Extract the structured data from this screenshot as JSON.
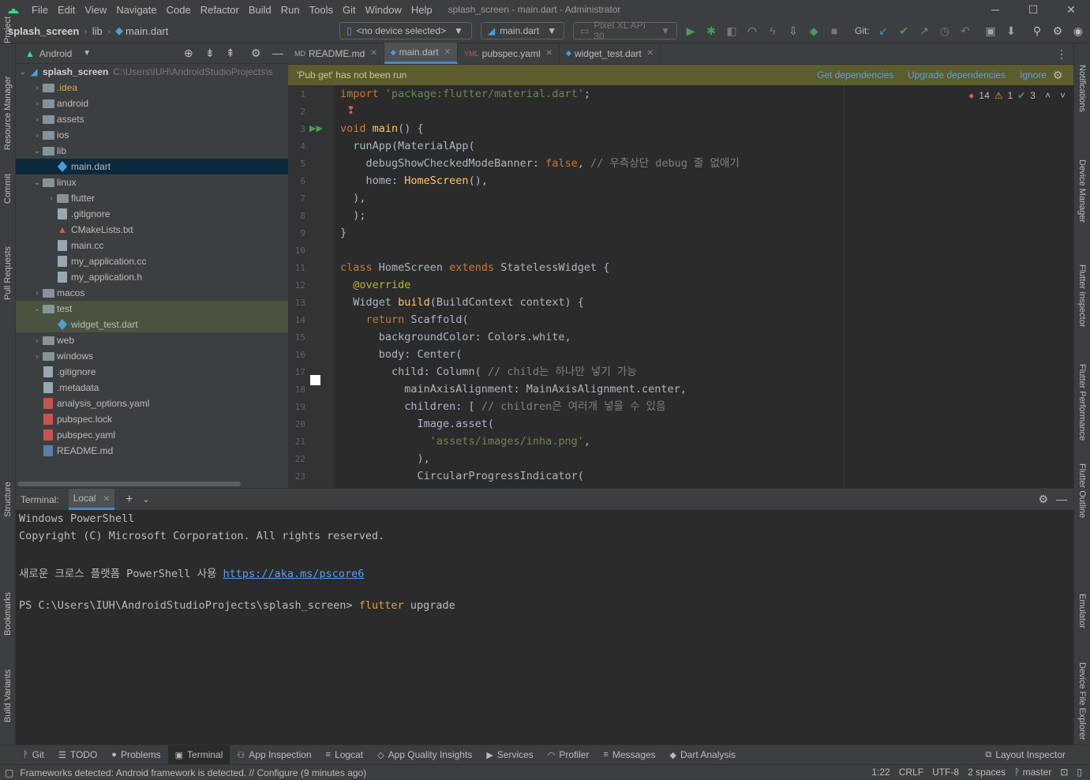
{
  "menus": [
    "File",
    "Edit",
    "View",
    "Navigate",
    "Code",
    "Refactor",
    "Build",
    "Run",
    "Tools",
    "Git",
    "Window",
    "Help"
  ],
  "window_title": "splash_screen - main.dart - Administrator",
  "breadcrumb": {
    "project": "splash_screen",
    "folder": "lib",
    "file": "main.dart"
  },
  "device_selector": "<no device selected>",
  "run_config": "main.dart",
  "emulator": "Pixel XL API 30",
  "git_label": "Git:",
  "project_panel": {
    "view": "Android",
    "root": "splash_screen",
    "root_path": "C:\\Users\\IUH\\AndroidStudioProjects\\s"
  },
  "tree": [
    {
      "label": ".idea",
      "arrow": "›",
      "depth": 1,
      "type": "folder",
      "color": "#d5a34a"
    },
    {
      "label": "android",
      "arrow": "›",
      "depth": 1,
      "type": "folder"
    },
    {
      "label": "assets",
      "arrow": "›",
      "depth": 1,
      "type": "folder"
    },
    {
      "label": "ios",
      "arrow": "›",
      "depth": 1,
      "type": "folder"
    },
    {
      "label": "lib",
      "arrow": "⌄",
      "depth": 1,
      "type": "folder"
    },
    {
      "label": "main.dart",
      "arrow": "",
      "depth": 2,
      "type": "dart",
      "sel": true
    },
    {
      "label": "linux",
      "arrow": "⌄",
      "depth": 1,
      "type": "folder"
    },
    {
      "label": "flutter",
      "arrow": "›",
      "depth": 2,
      "type": "folder"
    },
    {
      "label": ".gitignore",
      "arrow": "",
      "depth": 2,
      "type": "file"
    },
    {
      "label": "CMakeLists.txt",
      "arrow": "",
      "depth": 2,
      "type": "cmake"
    },
    {
      "label": "main.cc",
      "arrow": "",
      "depth": 2,
      "type": "file"
    },
    {
      "label": "my_application.cc",
      "arrow": "",
      "depth": 2,
      "type": "file"
    },
    {
      "label": "my_application.h",
      "arrow": "",
      "depth": 2,
      "type": "file"
    },
    {
      "label": "macos",
      "arrow": "›",
      "depth": 1,
      "type": "folder"
    },
    {
      "label": "test",
      "arrow": "⌄",
      "depth": 1,
      "type": "folder",
      "hl": true
    },
    {
      "label": "widget_test.dart",
      "arrow": "",
      "depth": 2,
      "type": "dart",
      "hl": true
    },
    {
      "label": "web",
      "arrow": "›",
      "depth": 1,
      "type": "folder"
    },
    {
      "label": "windows",
      "arrow": "›",
      "depth": 1,
      "type": "folder"
    },
    {
      "label": ".gitignore",
      "arrow": "",
      "depth": 1,
      "type": "file"
    },
    {
      "label": ".metadata",
      "arrow": "",
      "depth": 1,
      "type": "file"
    },
    {
      "label": "analysis_options.yaml",
      "arrow": "",
      "depth": 1,
      "type": "yaml"
    },
    {
      "label": "pubspec.lock",
      "arrow": "",
      "depth": 1,
      "type": "yaml"
    },
    {
      "label": "pubspec.yaml",
      "arrow": "",
      "depth": 1,
      "type": "yaml"
    },
    {
      "label": "README.md",
      "arrow": "",
      "depth": 1,
      "type": "md"
    }
  ],
  "tabs": [
    {
      "label": "README.md",
      "tag": "MD"
    },
    {
      "label": "main.dart",
      "tag": "◆",
      "active": true
    },
    {
      "label": "pubspec.yaml",
      "tag": "YML"
    },
    {
      "label": "widget_test.dart",
      "tag": "◆"
    }
  ],
  "banner": {
    "message": "'Pub get' has not been run",
    "actions": [
      "Get dependencies",
      "Upgrade dependencies",
      "Ignore"
    ]
  },
  "inspections": {
    "errors": "14",
    "warnings": "1",
    "ok": "3"
  },
  "code_lines": [
    "<span class='kw'>import</span> <span class='st'>'package:flutter/material.dart'</span>;",
    "",
    "<span class='kw'>void</span> <span class='fn'>main</span>() {",
    "  runApp(MaterialApp(",
    "    debugShowCheckedModeBanner: <span class='kw'>false</span>, <span class='cm'>// 우측상단 debug 줄 없애기</span>",
    "    home: <span class='fn'>HomeScreen</span>(),",
    "  ),",
    "  );",
    "}",
    "",
    "<span class='kw'>class</span> HomeScreen <span class='kw'>extends</span> StatelessWidget {",
    "  <span class='an'>@override</span>",
    "  Widget <span class='fn'>build</span>(BuildContext context) {",
    "    <span class='kw'>return</span> Scaffold(",
    "      backgroundColor: Colors.white,",
    "      body: Center(",
    "        child: Column( <span class='cm'>// child는 하나만 넣기 가능</span>",
    "          mainAxisAlignment: MainAxisAlignment.center,",
    "          children: [ <span class='cm'>// children은 여러개 넣을 수 있음</span>",
    "            Image.asset(",
    "              <span class='st'>'assets/images/inha.png'</span>,",
    "            ),",
    "            CircularProgressIndicator("
  ],
  "line_numbers": [
    "1",
    "2",
    "3",
    "4",
    "5",
    "6",
    "7",
    "8",
    "9",
    "10",
    "11",
    "12",
    "13",
    "14",
    "15",
    "16",
    "17",
    "18",
    "19",
    "20",
    "21",
    "22",
    "23"
  ],
  "terminal": {
    "title": "Terminal:",
    "tab": "Local",
    "lines": [
      "Windows PowerShell",
      "Copyright (C) Microsoft Corporation. All rights reserved.",
      "",
      "새로운 크로스 플랫폼 PowerShell 사용 ",
      "",
      "PS C:\\Users\\IUH\\AndroidStudioProjects\\splash_screen> "
    ],
    "link": "https://aka.ms/pscore6",
    "cmd": "flutter",
    "cmd_arg": " upgrade"
  },
  "left_tabs": [
    "Project",
    "Resource Manager",
    "Commit",
    "Pull Requests",
    "Structure",
    "Bookmarks",
    "Build Variants"
  ],
  "right_tabs": [
    "Notifications",
    "Device Manager",
    "Flutter Inspector",
    "Flutter Performance",
    "Flutter Outline",
    "Emulator",
    "Device File Explorer"
  ],
  "bottom_tabs": [
    {
      "label": "Git",
      "icon": "ᚹ"
    },
    {
      "label": "TODO",
      "icon": "☰"
    },
    {
      "label": "Problems",
      "icon": "●"
    },
    {
      "label": "Terminal",
      "icon": "▣",
      "active": true
    },
    {
      "label": "App Inspection",
      "icon": "⚇"
    },
    {
      "label": "Logcat",
      "icon": "≡"
    },
    {
      "label": "App Quality Insights",
      "icon": "◇"
    },
    {
      "label": "Services",
      "icon": "▶"
    },
    {
      "label": "Profiler",
      "icon": "◠"
    },
    {
      "label": "Messages",
      "icon": "≡"
    },
    {
      "label": "Dart Analysis",
      "icon": "◆"
    }
  ],
  "layout_inspector": "Layout Inspector",
  "status": {
    "message": "Frameworks detected: Android framework is detected. // Configure (9 minutes ago)",
    "position": "1:22",
    "line_sep": "CRLF",
    "encoding": "UTF-8",
    "indent": "2 spaces",
    "branch": "master"
  }
}
